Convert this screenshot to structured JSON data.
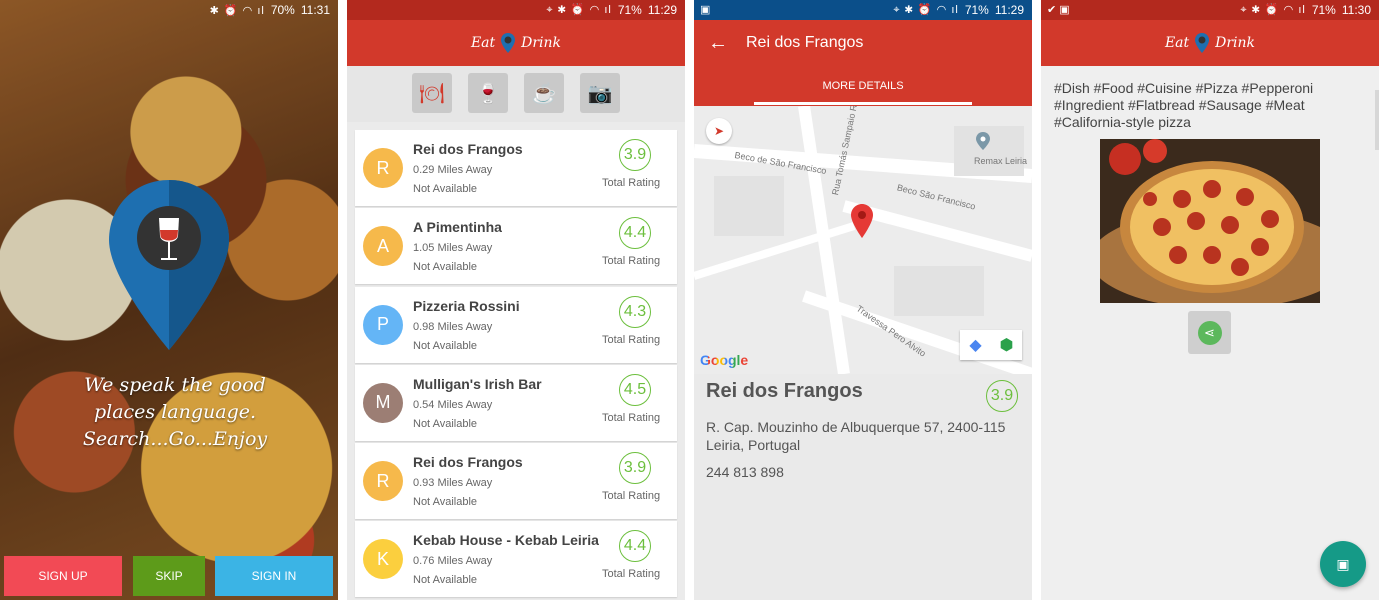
{
  "colors": {
    "primary": "#d2392b",
    "rating": "#6cbf3d",
    "signup": "#f24a55",
    "skip": "#5d9b1a",
    "signin": "#3bb4e5",
    "fab": "#159a87"
  },
  "logo": {
    "left": "Eat",
    "right": "Drink"
  },
  "screen1": {
    "status": {
      "battery": "70%",
      "time": "11:31"
    },
    "tagline": "We speak the good places language. Search...Go...Enjoy",
    "buttons": {
      "signup": "SIGN UP",
      "skip": "SKIP",
      "signin": "SIGN IN"
    }
  },
  "screen2": {
    "status": {
      "battery": "71%",
      "time": "11:29"
    },
    "categories": [
      "restaurant-icon",
      "wine-glass-icon",
      "coffee-cup-icon",
      "camera-icon"
    ],
    "restaurants": [
      {
        "initial": "R",
        "name": "Rei dos Frangos",
        "distance": "0.29 Miles Away",
        "availability": "Not Available",
        "rating": "3.9",
        "rating_label": "Total Rating",
        "avatar_color": "#f6b94b"
      },
      {
        "initial": "A",
        "name": "A Pimentinha",
        "distance": "1.05 Miles Away",
        "availability": "Not Available",
        "rating": "4.4",
        "rating_label": "Total Rating",
        "avatar_color": "#f6b94b"
      },
      {
        "initial": "P",
        "name": "Pizzeria Rossini",
        "distance": "0.98 Miles Away",
        "availability": "Not Available",
        "rating": "4.3",
        "rating_label": "Total Rating",
        "avatar_color": "#64b5f6"
      },
      {
        "initial": "M",
        "name": "Mulligan's Irish Bar",
        "distance": "0.54 Miles Away",
        "availability": "Not Available",
        "rating": "4.5",
        "rating_label": "Total Rating",
        "avatar_color": "#9c7e74"
      },
      {
        "initial": "R",
        "name": "Rei dos Frangos",
        "distance": "0.93 Miles Away",
        "availability": "Not Available",
        "rating": "3.9",
        "rating_label": "Total Rating",
        "avatar_color": "#f6b94b"
      },
      {
        "initial": "K",
        "name": "Kebab House - Kebab Leiria",
        "distance": "0.76 Miles Away",
        "availability": "Not Available",
        "rating": "4.4",
        "rating_label": "Total Rating",
        "avatar_color": "#fbcf3e"
      }
    ]
  },
  "screen3": {
    "status": {
      "battery": "71%",
      "time": "11:29"
    },
    "title": "Rei dos Frangos",
    "tab": "MORE DETAILS",
    "map": {
      "streets": [
        "Beco de São Francisco",
        "Rua Tomás Sampaio Rio",
        "Beco São Francisco",
        "Travessa Pero Alvito"
      ],
      "poi": "Remax Leiria",
      "google": "Google"
    },
    "name": "Rei dos Frangos",
    "rating": "3.9",
    "address": "R. Cap. Mouzinho de Albuquerque 57, 2400-115 Leiria, Portugal",
    "phone": "244 813 898"
  },
  "screen4": {
    "status": {
      "battery": "71%",
      "time": "11:30"
    },
    "tags": "#Dish #Food #Cuisine #Pizza #Pepperoni #Ingredient #Flatbread #Sausage #Meat #California-style pizza"
  }
}
